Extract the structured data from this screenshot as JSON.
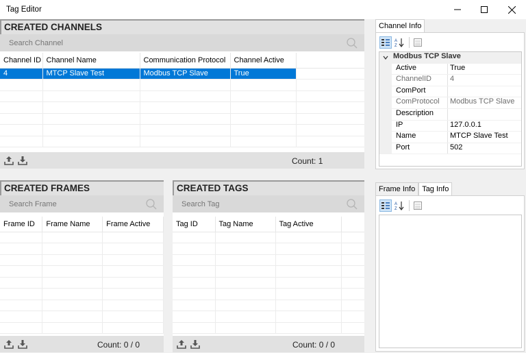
{
  "window": {
    "title": "Tag Editor"
  },
  "channels": {
    "header": "CREATED CHANNELS",
    "search_placeholder": "Search Channel",
    "columns": [
      "Channel ID",
      "Channel Name",
      "Communication Protocol",
      "Channel Active"
    ],
    "rows": [
      [
        "4",
        "MTCP Slave Test",
        "Modbus TCP Slave",
        "True"
      ]
    ],
    "count_label": "Count: 1"
  },
  "frames": {
    "header": "CREATED FRAMES",
    "search_placeholder": "Search Frame",
    "columns": [
      "Frame ID",
      "Frame Name",
      "Frame Active"
    ],
    "count_label": "Count: 0 / 0"
  },
  "tags": {
    "header": "CREATED TAGS",
    "search_placeholder": "Search Tag",
    "columns": [
      "Tag ID",
      "Tag Name",
      "Tag Active"
    ],
    "count_label": "Count: 0 / 0"
  },
  "channel_info": {
    "tab": "Channel Info",
    "category": "Modbus TCP Slave",
    "properties": [
      {
        "key": "Active",
        "value": "True",
        "readonly": false
      },
      {
        "key": "ChannelID",
        "value": "4",
        "readonly": true
      },
      {
        "key": "ComPort",
        "value": "",
        "readonly": false
      },
      {
        "key": "ComProtocol",
        "value": "Modbus TCP Slave",
        "readonly": true
      },
      {
        "key": "Description",
        "value": "",
        "readonly": false
      },
      {
        "key": "IP",
        "value": "127.0.0.1",
        "readonly": false
      },
      {
        "key": "Name",
        "value": "MTCP Slave Test",
        "readonly": false
      },
      {
        "key": "Port",
        "value": "502",
        "readonly": false
      }
    ]
  },
  "info_tabs": {
    "frame_info": "Frame Info",
    "tag_info": "Tag Info"
  },
  "colors": {
    "selection": "#0078d7"
  }
}
